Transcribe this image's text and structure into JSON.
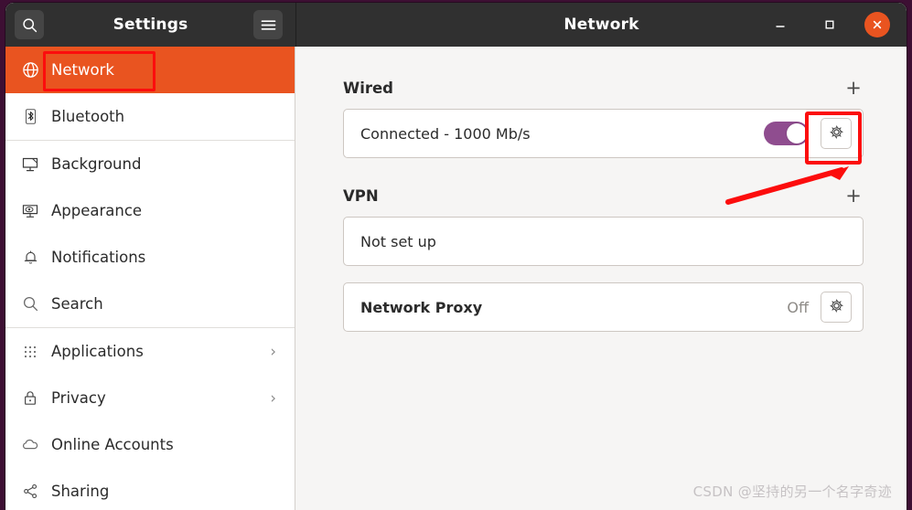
{
  "desktop": {
    "background_color": "#3d0f33"
  },
  "sidebar_header": {
    "title": "Settings",
    "search_icon": "search-icon",
    "menu_icon": "hamburger-menu-icon"
  },
  "window_header": {
    "title": "Network",
    "minimize_label": "–",
    "maximize_label": "□",
    "close_label": "×",
    "close_color": "#e95420"
  },
  "sidebar": {
    "selected": "Network",
    "accent_color": "#e95420",
    "items": [
      {
        "label": "Network",
        "icon": "globe-icon",
        "chevron": "",
        "selected": true
      },
      {
        "label": "Bluetooth",
        "icon": "bluetooth-icon",
        "chevron": "",
        "selected": false
      },
      {
        "label": "Background",
        "icon": "monitor-icon",
        "chevron": "",
        "selected": false
      },
      {
        "label": "Appearance",
        "icon": "appearance-icon",
        "chevron": "",
        "selected": false
      },
      {
        "label": "Notifications",
        "icon": "bell-icon",
        "chevron": "",
        "selected": false
      },
      {
        "label": "Search",
        "icon": "magnifier-icon",
        "chevron": "",
        "selected": false
      },
      {
        "label": "Applications",
        "icon": "grid-apps-icon",
        "chevron": "›",
        "selected": false
      },
      {
        "label": "Privacy",
        "icon": "lock-icon",
        "chevron": "›",
        "selected": false
      },
      {
        "label": "Online Accounts",
        "icon": "cloud-icon",
        "chevron": "",
        "selected": false
      },
      {
        "label": "Sharing",
        "icon": "share-nodes-icon",
        "chevron": "",
        "selected": false
      }
    ]
  },
  "main": {
    "sections": [
      {
        "title": "Wired",
        "add_label": "+",
        "row_label": "Connected - 1000 Mb/s",
        "toggle_on": true,
        "toggle_color": "#8f4d8f",
        "gear_icon": "gear-icon"
      },
      {
        "title": "VPN",
        "add_label": "+",
        "row_label": "Not set up"
      }
    ],
    "proxy": {
      "label": "Network Proxy",
      "status": "Off",
      "gear_icon": "gear-icon"
    }
  },
  "annotations": {
    "highlight_color": "#fc0d0d",
    "network_box": "red-highlight-box-network",
    "gear_box": "red-highlight-box-gear",
    "arrow": "red-arrow-pointing-to-gear"
  },
  "watermark": {
    "text": "CSDN @坚持的另一个名字奇迹"
  }
}
